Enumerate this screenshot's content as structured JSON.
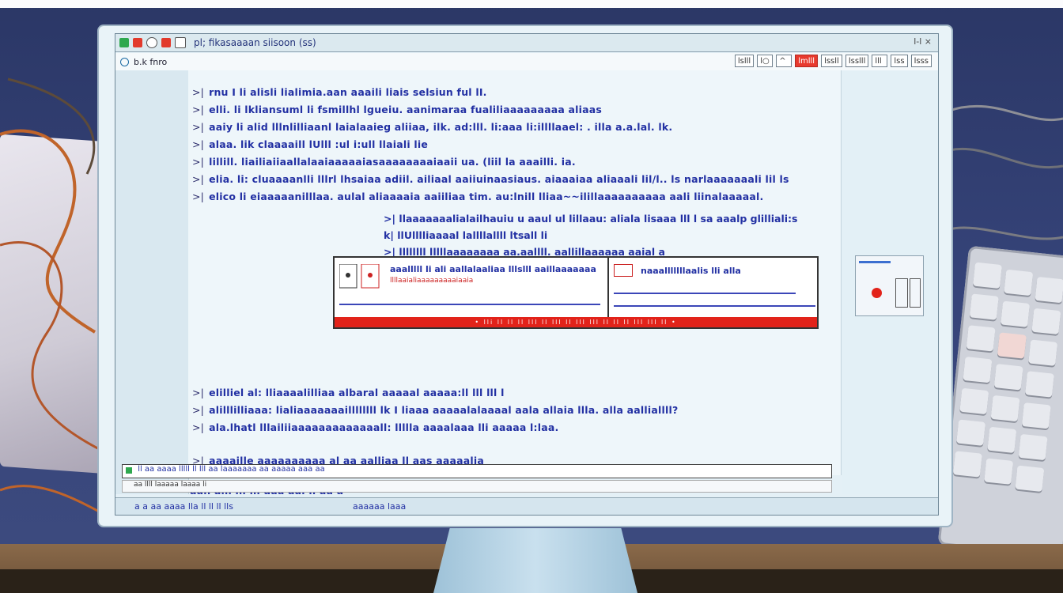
{
  "window": {
    "title": "pl; fikasaaaan siisoon (ss)",
    "controls": "l-l ×"
  },
  "toolbar": {
    "address": "b.k fnro",
    "tools": [
      "lslll",
      "l○",
      "^",
      "lmlll",
      "lssll",
      "lsslll",
      "lll",
      "lss",
      "lsss"
    ]
  },
  "document": {
    "lines": [
      {
        "mark": ">|",
        "text": "rnu I li alisli lialimia.aan aaaili liais selsiun ful lI."
      },
      {
        "mark": ">|",
        "text": "elli. li lkliansuml li fsmillhl lgueiu. aanimaraa fualiliaaaaaaaaa aliaas"
      },
      {
        "mark": ">|",
        "text": "aaiy li alid lllnlilliaanl laialaaieg aliiaa, ilk. ad:lll. li:aaa li:illllaael: . illa a.a.lal. lk."
      },
      {
        "mark": ">|",
        "text": "alaa. lik claaaaill lUlll :ul i:ull llaiali lie"
      },
      {
        "mark": ">|",
        "text": "lillill. liailiaiiaallalaaiaaaaaiasaaaaaaaaiaaii ua. (liil la aaailli. ia."
      },
      {
        "mark": ">|",
        "text": "elia. li: cluaaaanlli lllrl lhsaiaa adiil. ailiaal aaiiuinaasiaus. aiaaaiaa  aliaaali lil/l.. ls narlaaaaaaali lil ls"
      },
      {
        "mark": ">|",
        "text": "elico li eiaaaaanilllaa. aulal aliaaaaia aaiiliaa tim. au:lnill lliaa~~ilillaaaaaaaaaa aali liinalaaaaal."
      }
    ],
    "sublines": [
      {
        "mark": ">|",
        "text": "llaaaaaaalialailhauiu u aaul ul lillaau: aliala lisaaa lll l sa aaalp glilliali:s"
      },
      {
        "mark": "k|",
        "text": "llUlllliaaaal lallllallll ltsall li"
      },
      {
        "mark": ">|",
        "text": "llllllll lllllaaaaaaaa aa.aallll. aallillaaaaaa aaial a"
      }
    ],
    "panel": {
      "left_label": "aaalllll li ali aallalaaliaa  lllslll aaillaaaaaaa",
      "left_sub": "llllaaialiaaaaaaaaaiaaia",
      "right_label": "naaalllllllaalis lli alla",
      "bar_text": "• lli ll ll ll lll ll lll ll lll lll ll ll ll lll lll ll •"
    },
    "lines2": [
      {
        "mark": ">|",
        "text": "elilliel al: lliaaaalilliaa albaral aaaaal aaaaa:ll lll lll l"
      },
      {
        "mark": ">|",
        "text": "alilllilliaaa: lialiaaaaaaaillllllll lk I liaaa aaaaalalaaaal aala allaia llla. alla aalliallll?"
      },
      {
        "mark": ">|",
        "text": "ala.lhatl lllailiiaaaaaaaaaaaaall: llllla  aaaalaaa lli aaaaa l:laa."
      }
    ],
    "note": {
      "mark": ">|",
      "text": "aaaaille aaaaaaaaaa al  aa aalliaa ll aas aaaaalia"
    },
    "footer_line": "aan alll lll lll aaa aal ll aa a"
  },
  "findbar": {
    "text": "ll aa aaaa lllll  ll lll aa   laaaaaaa  aa        aaaaa  aaa aa",
    "sub": "aa llll laaaaa laaaa li"
  },
  "statusbar": {
    "left": "a  a  aa aaaa lla ll  ll  ll  lls",
    "right": "aaaaaa laaa"
  },
  "colors": {
    "text_blue": "#2230a3",
    "accent_red": "#e2231a",
    "screen_bg": "#e4f0f6"
  }
}
